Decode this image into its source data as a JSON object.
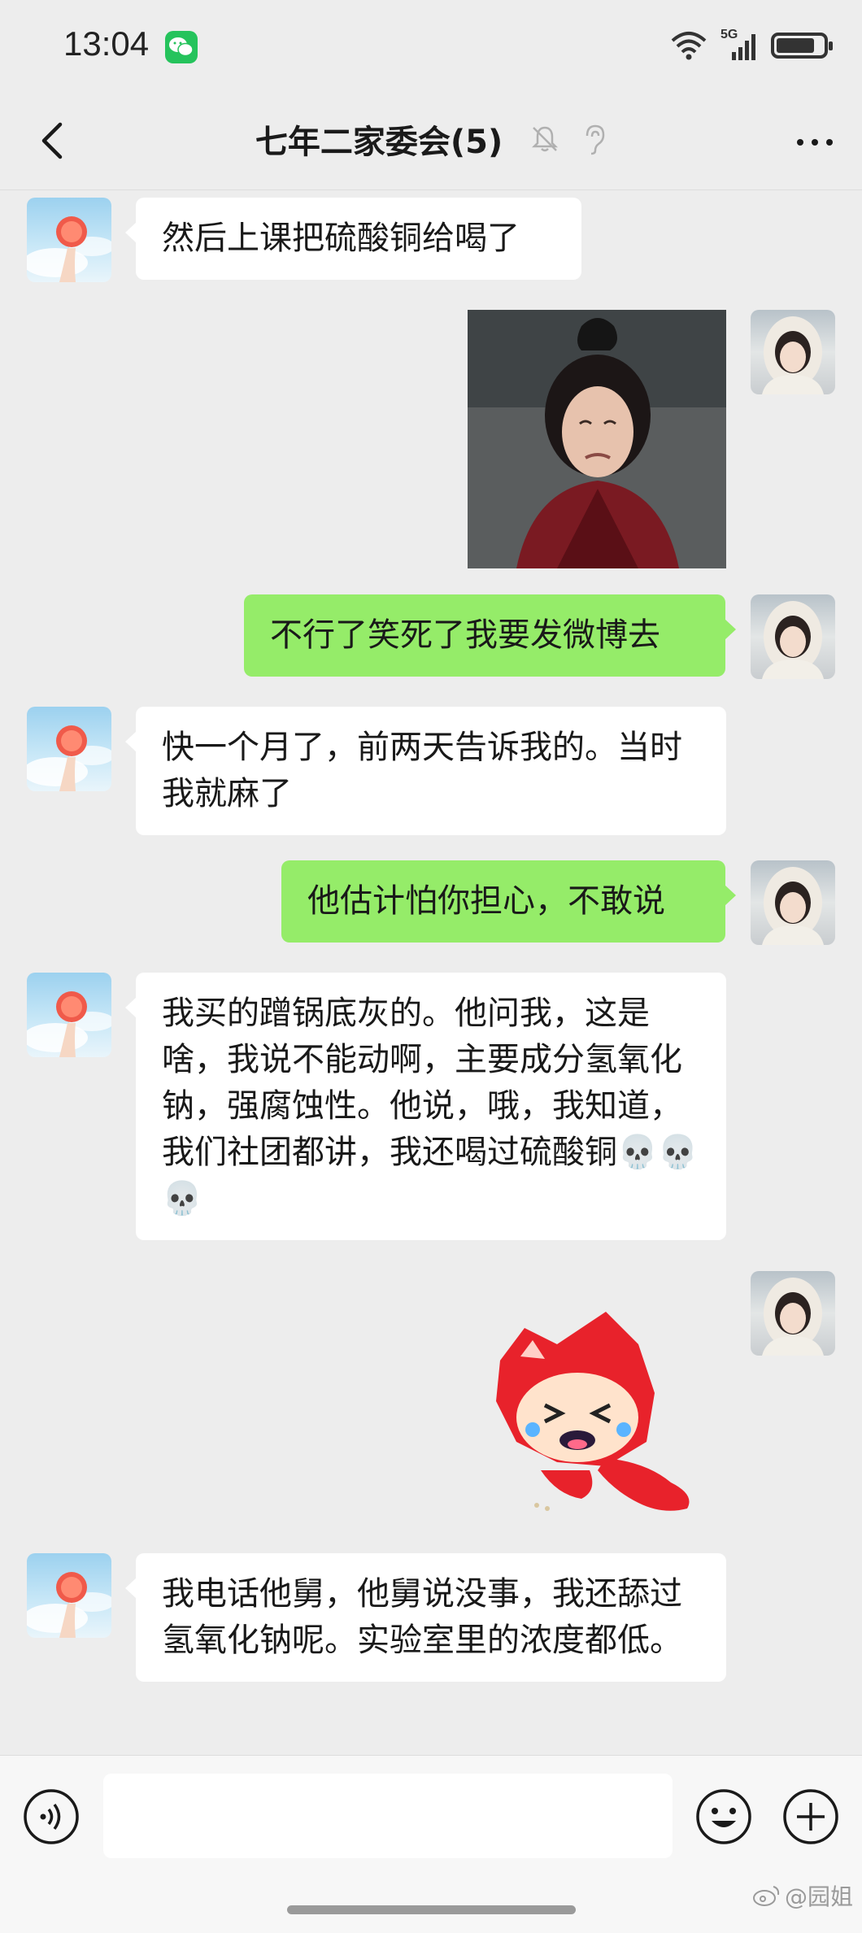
{
  "status_bar": {
    "time": "13:04",
    "network": "5G",
    "icons": [
      "wechat-notification-icon",
      "wifi-icon",
      "signal-icon",
      "battery-icon"
    ]
  },
  "header": {
    "title": "七年二家委会(5)",
    "icons": [
      "back-icon",
      "mute-icon",
      "earpiece-icon",
      "more-icon"
    ]
  },
  "messages": [
    {
      "side": "left",
      "type": "text",
      "text": "然后上课把硫酸铜给喝了"
    },
    {
      "side": "right",
      "type": "image",
      "content": "meme photo"
    },
    {
      "side": "right",
      "type": "text",
      "text": "不行了笑死了我要发微博去"
    },
    {
      "side": "left",
      "type": "text",
      "text": "快一个月了，前两天告诉我的。当时我就麻了"
    },
    {
      "side": "right",
      "type": "text",
      "text": "他估计怕你担心，不敢说"
    },
    {
      "side": "left",
      "type": "text",
      "text": "我买的蹭锅底灰的。他问我，这是啥，我说不能动啊，主要成分氢氧化钠，强腐蚀性。他说，哦，我知道，我们社团都讲，我还喝过硫酸铜💀💀💀"
    },
    {
      "side": "right",
      "type": "sticker",
      "content": "red fox sticker"
    },
    {
      "side": "left",
      "type": "text",
      "text": "我电话他舅，他舅说没事，我还舔过氢氧化钠呢。实验室里的浓度都低。"
    }
  ],
  "input_bar": {
    "value": "",
    "icons": [
      "voice-icon",
      "emoji-icon",
      "plus-icon"
    ]
  },
  "watermark": "@园姐",
  "colors": {
    "background": "#ededed",
    "sent_bubble": "#95ec69",
    "received_bubble": "#ffffff"
  }
}
